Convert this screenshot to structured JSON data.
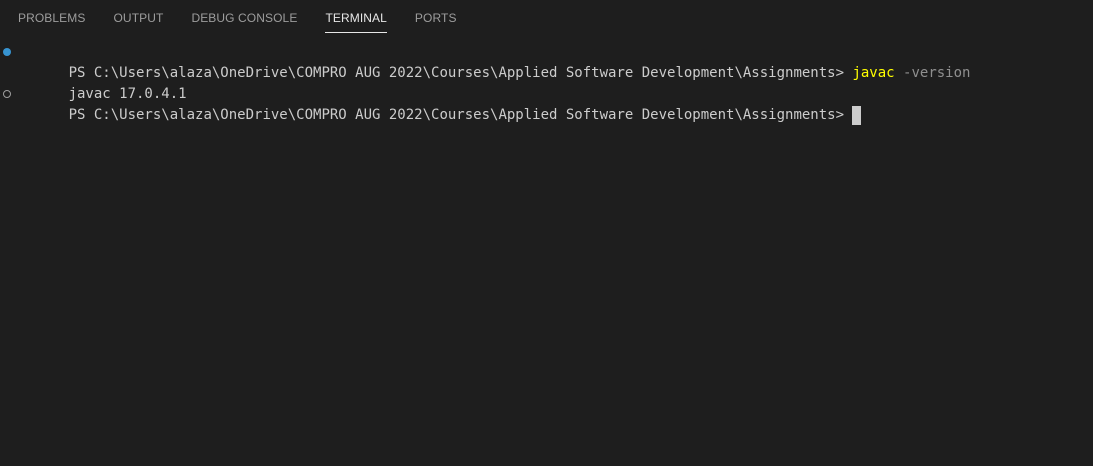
{
  "tabs": [
    {
      "label": "PROBLEMS",
      "active": false
    },
    {
      "label": "OUTPUT",
      "active": false
    },
    {
      "label": "DEBUG CONSOLE",
      "active": false
    },
    {
      "label": "TERMINAL",
      "active": true
    },
    {
      "label": "PORTS",
      "active": false
    }
  ],
  "terminal": {
    "line1": {
      "prompt": "PS C:\\Users\\alaza\\OneDrive\\COMPRO AUG 2022\\Courses\\Applied Software Development\\Assignments> ",
      "command": "javac",
      "args": " -version",
      "decoration": "success-dot-icon"
    },
    "line2": {
      "output": "javac 17.0.4.1"
    },
    "line3": {
      "prompt": "PS C:\\Users\\alaza\\OneDrive\\COMPRO AUG 2022\\Courses\\Applied Software Development\\Assignments> ",
      "decoration": "default-circle-icon"
    }
  },
  "colors": {
    "background": "#1e1e1e",
    "foreground": "#cccccc",
    "command": "#ffff00",
    "argument": "#8f8f8f",
    "success_decoration": "#3794d1"
  }
}
